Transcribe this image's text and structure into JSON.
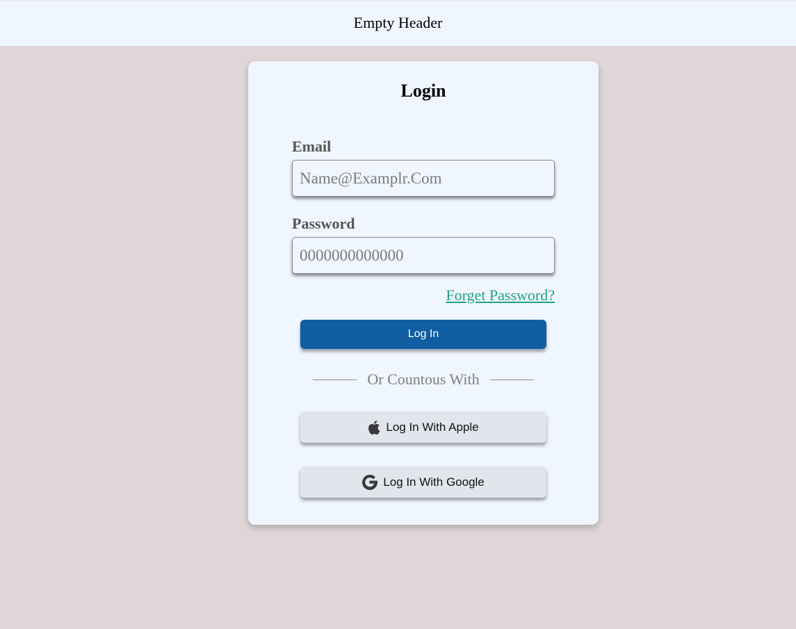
{
  "header": {
    "title": "Empty Header"
  },
  "login": {
    "title": "Login",
    "email": {
      "label": "Email",
      "placeholder": "Name@Examplr.Com",
      "value": ""
    },
    "password": {
      "label": "Password",
      "placeholder": "0000000000000",
      "value": ""
    },
    "forgot_password": "Forget Password?",
    "submit_label": "Log In",
    "divider_text": "Or Countous With",
    "social": {
      "apple_label": "Log In With Apple",
      "apple_icon": "apple-icon",
      "google_label": "Log In With Google",
      "google_icon": "google-icon"
    }
  },
  "colors": {
    "page_background": "#e0d6d7",
    "card_background": "#eff6ff",
    "primary_button": "#105ea1",
    "link": "#1fa37a",
    "social_button": "#e1e6ed"
  }
}
